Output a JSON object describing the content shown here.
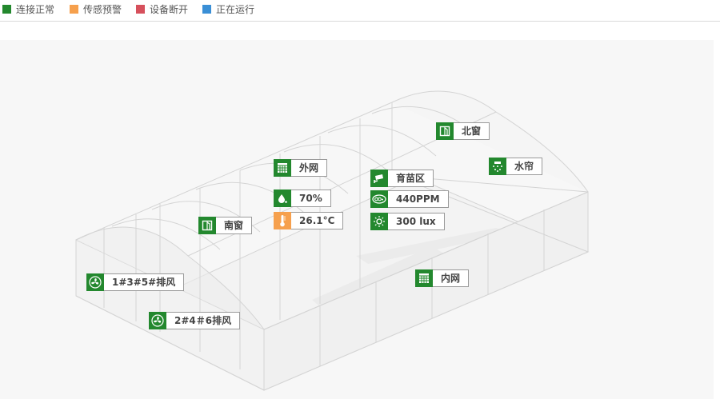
{
  "legend": [
    {
      "label": "连接正常",
      "color": "#23882e"
    },
    {
      "label": "传感预警",
      "color": "#f6a04d"
    },
    {
      "label": "设备断开",
      "color": "#d6505c"
    },
    {
      "label": "正在运行",
      "color": "#3a8fd6"
    }
  ],
  "devices": {
    "north_window": {
      "label": "北窗",
      "icon": "window-icon",
      "status": "连接正常"
    },
    "water_curtain": {
      "label": "水帘",
      "icon": "sprinkler-icon",
      "status": "连接正常"
    },
    "outer_net": {
      "label": "外网",
      "icon": "net-icon",
      "status": "连接正常"
    },
    "nursery": {
      "label": "育苗区",
      "icon": "camera-icon",
      "status": "连接正常"
    },
    "humidity": {
      "label": "70%",
      "icon": "water-drop-icon",
      "status": "连接正常"
    },
    "co2": {
      "label": "440PPM",
      "icon": "co2-icon",
      "status": "连接正常"
    },
    "temperature": {
      "label": "26.1°C",
      "icon": "thermometer-icon",
      "status": "传感预警"
    },
    "light": {
      "label": "300 lux",
      "icon": "sun-icon",
      "status": "连接正常"
    },
    "south_window": {
      "label": "南窗",
      "icon": "window-icon",
      "status": "连接正常"
    },
    "inner_net": {
      "label": "内网",
      "icon": "net-icon",
      "status": "连接正常"
    },
    "fan_135": {
      "label": "1#3#5#排风",
      "icon": "fan-icon",
      "status": "连接正常"
    },
    "fan_246": {
      "label": "2#4＃6排风",
      "icon": "fan-icon",
      "status": "连接正常"
    }
  }
}
